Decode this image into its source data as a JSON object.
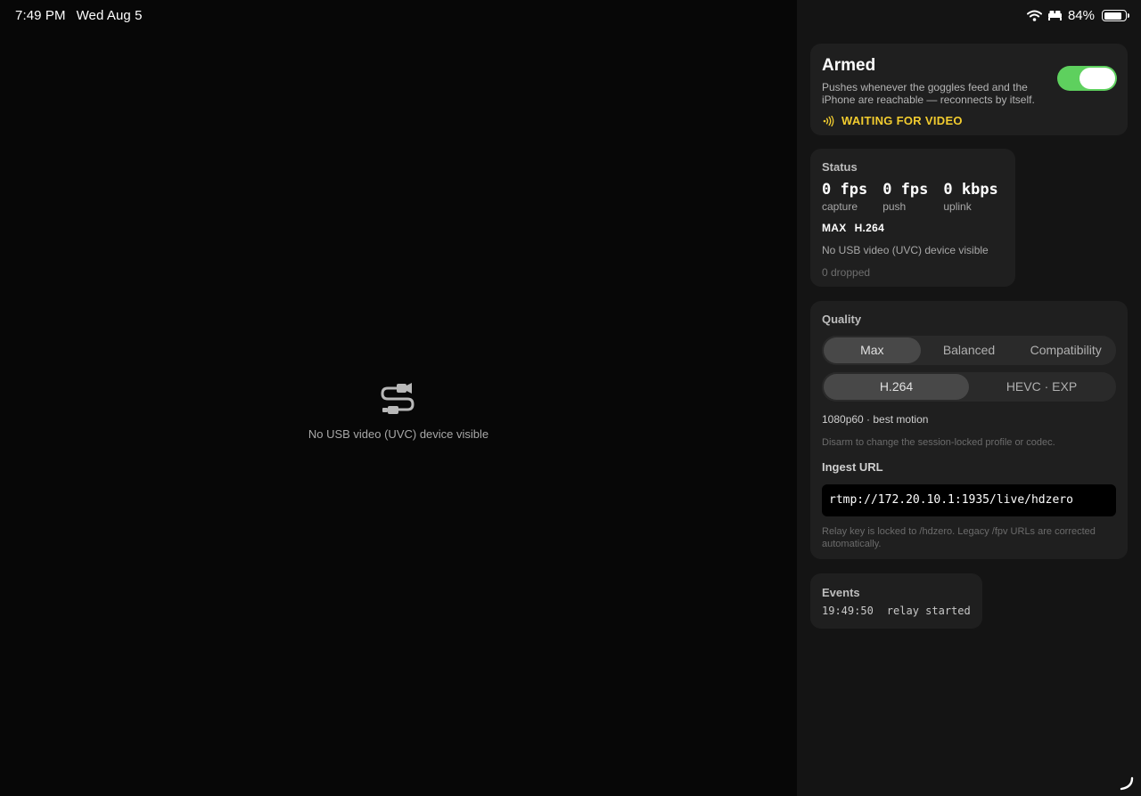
{
  "status_bar": {
    "time": "7:49 PM",
    "date": "Wed Aug 5",
    "battery": "84%",
    "battery_level": 0.84
  },
  "video": {
    "icon": "usb-video-icon",
    "message": "No USB video (UVC) device visible"
  },
  "armed": {
    "title": "Armed",
    "description": "Pushes whenever the goggles feed and the iPhone are reachable — reconnects by itself.",
    "state": "WAITING FOR VIDEO",
    "toggle_on": true,
    "accent": "#f2cc2f",
    "toggle_color": "#5ed05e"
  },
  "status": {
    "label": "Status",
    "metrics": [
      {
        "value": "0 fps",
        "label": "capture"
      },
      {
        "value": "0 fps",
        "label": "push"
      },
      {
        "value": "0 kbps",
        "label": "uplink"
      }
    ],
    "profile": "MAX",
    "codec": "H.264",
    "message": "No USB video (UVC) device visible",
    "dropped": "0 dropped"
  },
  "quality": {
    "label": "Quality",
    "profiles": [
      {
        "label": "Max",
        "active": true
      },
      {
        "label": "Balanced",
        "active": false
      },
      {
        "label": "Compatibility",
        "active": false
      }
    ],
    "codecs": [
      {
        "label": "H.264",
        "active": true
      },
      {
        "label": "HEVC · EXP",
        "active": false
      }
    ],
    "note": "1080p60 · best motion",
    "hint": "Disarm to change the session-locked profile or codec.",
    "ingest_label": "Ingest URL",
    "ingest_url": "rtmp://172.20.10.1:1935/live/hdzero",
    "ingest_note": "Relay key is locked to /hdzero. Legacy /fpv URLs are corrected automatically."
  },
  "events": {
    "label": "Events",
    "items": [
      {
        "time": "19:49:50",
        "text": "relay started"
      }
    ]
  }
}
